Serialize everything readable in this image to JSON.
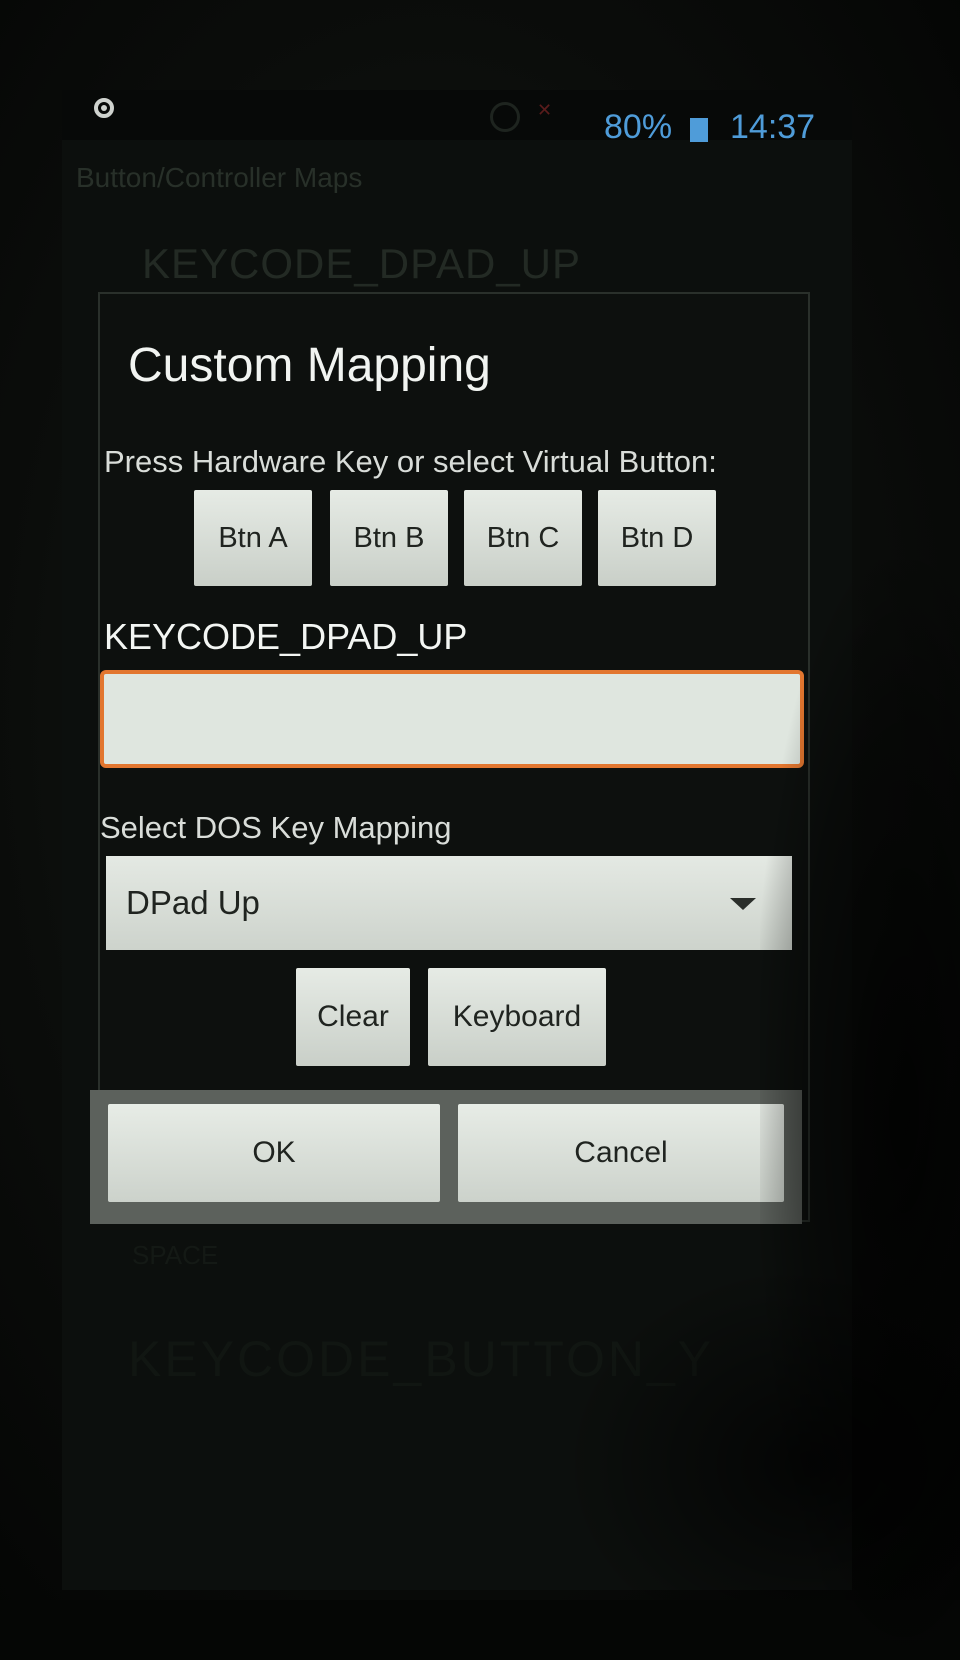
{
  "status_bar": {
    "battery": "80%",
    "time": "14:37",
    "accent_color": "#4f9cd9"
  },
  "background": {
    "app_title": "Button/Controller Maps",
    "keycode_top": "KEYCODE_DPAD_UP",
    "space_label": "SPACE",
    "keycode_bottom": "KEYCODE_BUTTON_Y"
  },
  "dialog": {
    "title": "Custom Mapping",
    "instruction": "Press Hardware Key or select Virtual Button:",
    "virtual_buttons": [
      "Btn A",
      "Btn B",
      "Btn C",
      "Btn D"
    ],
    "key_label": "KEYCODE_DPAD_UP",
    "key_input": {
      "value": "",
      "focus_color": "#e2762f"
    },
    "dos_label": "Select DOS Key Mapping",
    "dos_select": {
      "selected": "DPad Up"
    },
    "actions": {
      "clear": "Clear",
      "keyboard": "Keyboard"
    },
    "footer": {
      "ok": "OK",
      "cancel": "Cancel"
    }
  },
  "icons": {
    "status_left": "target-ring-icon",
    "alarm": "alarm-icon",
    "signal": "no-signal-icon",
    "battery": "battery-icon",
    "dropdown": "dropdown-arrow-icon"
  }
}
